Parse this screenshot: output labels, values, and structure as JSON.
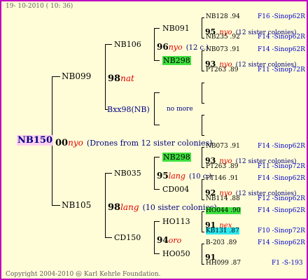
{
  "header": {
    "date": "19- 10-2010 ( 10: 36)"
  },
  "footer": {
    "copyright": "Copyright 2004-2010 @ Karl Kehrle Foundation."
  },
  "root": {
    "id": "NB150",
    "gen": "00",
    "mark": "nyo",
    "note": "(Drones from 12 sister colonies)"
  },
  "l1": [
    {
      "id": "NB099",
      "gen": "98",
      "mark": "nat"
    },
    {
      "id": "NB105",
      "gen": "98",
      "mark": "lang",
      "note": "(10 sister colonies)"
    }
  ],
  "l2": [
    {
      "id": "NB106",
      "gen": "96",
      "mark": "nyo",
      "note": "(12 c.)"
    },
    {
      "id": "Bxx98(NB)",
      "note": "no more"
    },
    {
      "id": "NB035",
      "gen": "95",
      "mark": "lang",
      "note": "(10 c.)"
    },
    {
      "id": "CD150",
      "gen": "94",
      "mark": "oro"
    }
  ],
  "l3": [
    {
      "id": "NB091",
      "gen": "95",
      "mark": "nyo",
      "note": "(12 sister colonies)"
    },
    {
      "id": "NB298"
    },
    {
      "id": "NB298",
      "gen": "93",
      "mark": "nyo",
      "note": "(12 sister colonies)"
    },
    {
      "id": "CD004",
      "gen": "92",
      "mark": "nyo",
      "note": "(12 sister colonies)"
    },
    {
      "id": "HO113",
      "gen": "91",
      "mark": "nex"
    },
    {
      "id": "HO050",
      "gen": "91"
    }
  ],
  "l4": [
    {
      "id": "NB128",
      "score": ".94",
      "source": "F16 -Sinop62R"
    },
    {
      "id": "NB235",
      "score": ".92",
      "source": "F14 -Sinop62R"
    },
    {
      "id": "NB073",
      "score": ".91",
      "source": "F14 -Sinop62R"
    },
    {
      "id": "PT263",
      "score": ".89",
      "source": "F11 -Sinop72R"
    },
    {
      "id": "NB073",
      "score": ".91",
      "source": "F14 -Sinop62R"
    },
    {
      "id": "PT263",
      "score": ".89",
      "source": "F11 -Sinop72R"
    },
    {
      "id": "PT146",
      "score": ".91",
      "source": "F14 -Sinop62R"
    },
    {
      "id": "NB114",
      "score": ".88",
      "source": "F12 -Sinop62R"
    },
    {
      "id": "HO044",
      "score": ".90",
      "source": "F14 -Sinop62R"
    },
    {
      "id": "KB131",
      "score": ".87",
      "source": "F10 -Sinop72R"
    },
    {
      "id": "B-203",
      "score": ".89",
      "source": "F14 -Sinop62R"
    },
    {
      "id": "HH099",
      "score": ".87",
      "source": "F1 -S-193"
    }
  ],
  "colors": {
    "border": "#c000c0",
    "background": "#fffdd8",
    "highlight_green": "#40e040",
    "highlight_cyan": "#30e8f0",
    "mark": "#e00000",
    "source": "#0000cc"
  }
}
